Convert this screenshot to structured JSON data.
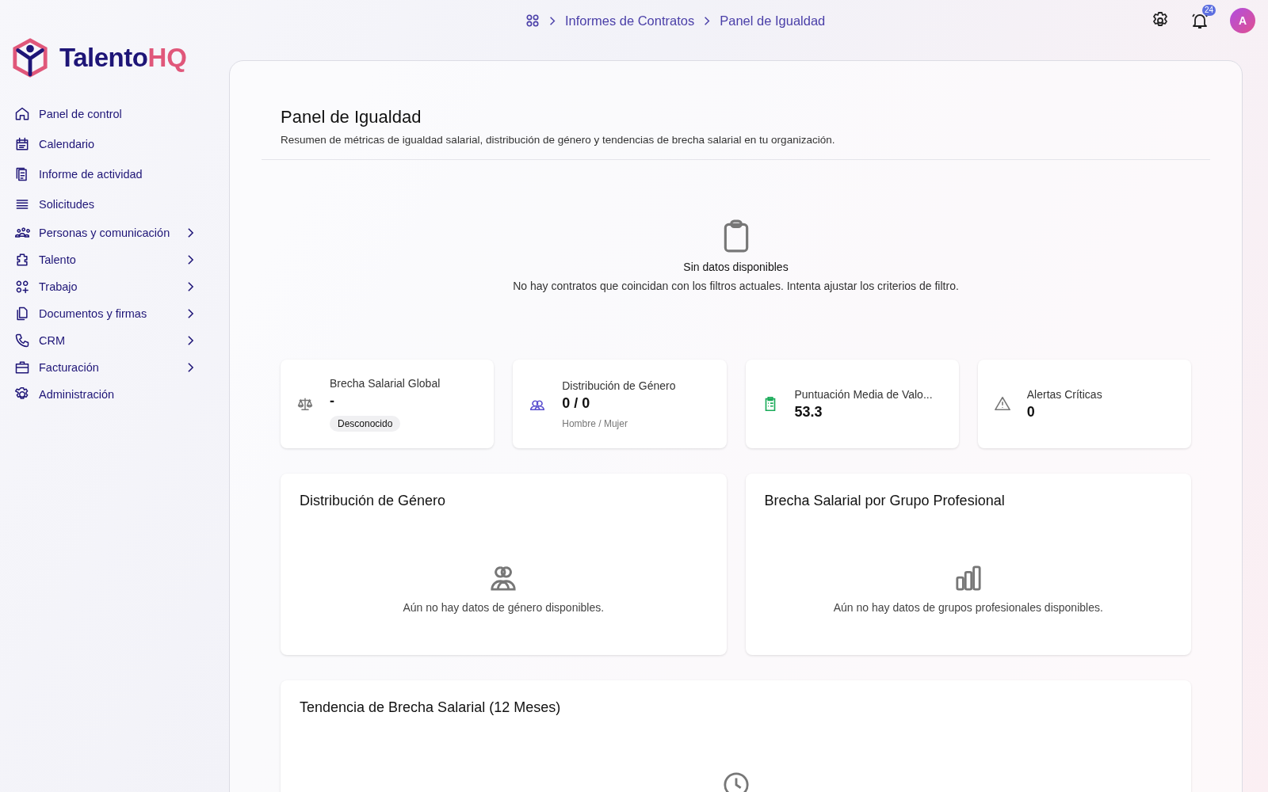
{
  "logo": {
    "part_1": "Talento",
    "part_2": "HQ"
  },
  "breadcrumb": [
    "Informes de Contratos",
    "Panel de Igualdad"
  ],
  "topbar": {
    "notification_count": "24",
    "avatar": "A"
  },
  "sidebar": {
    "items": [
      {
        "label": "Panel de control",
        "expandable": false
      },
      {
        "label": "Calendario",
        "expandable": false
      },
      {
        "label": "Informe de actividad",
        "expandable": false
      },
      {
        "label": "Solicitudes",
        "expandable": false
      },
      {
        "label": "Personas y comunicación",
        "expandable": true
      },
      {
        "label": "Talento",
        "expandable": true
      },
      {
        "label": "Trabajo",
        "expandable": true
      },
      {
        "label": "Documentos y firmas",
        "expandable": true
      },
      {
        "label": "CRM",
        "expandable": true
      },
      {
        "label": "Facturación",
        "expandable": true
      },
      {
        "label": "Administración",
        "expandable": false
      }
    ]
  },
  "page": {
    "title": "Panel de Igualdad",
    "subtitle": "Resumen de métricas de igualdad salarial, distribución de género y tendencias de brecha salarial en tu organización."
  },
  "empty_state": {
    "title": "Sin datos disponibles",
    "message": "No hay contratos que coincidan con los filtros actuales. Intenta ajustar los criterios de filtro."
  },
  "stats": [
    {
      "label": "Brecha Salarial Global",
      "value": "-",
      "badge": "Desconocido"
    },
    {
      "label": "Distribución de Género",
      "value": "0 / 0",
      "note": "Hombre / Mujer"
    },
    {
      "label": "Puntuación Media de Valo...",
      "value": "53.3"
    },
    {
      "label": "Alertas Críticas",
      "value": "0"
    }
  ],
  "panels": [
    {
      "title": "Distribución de Género",
      "message": "Aún no hay datos de género disponibles."
    },
    {
      "title": "Brecha Salarial por Grupo Profesional",
      "message": "Aún no hay datos de grupos profesionales disponibles."
    }
  ],
  "trend": {
    "title": "Tendencia de Brecha Salarial (12 Meses)"
  }
}
